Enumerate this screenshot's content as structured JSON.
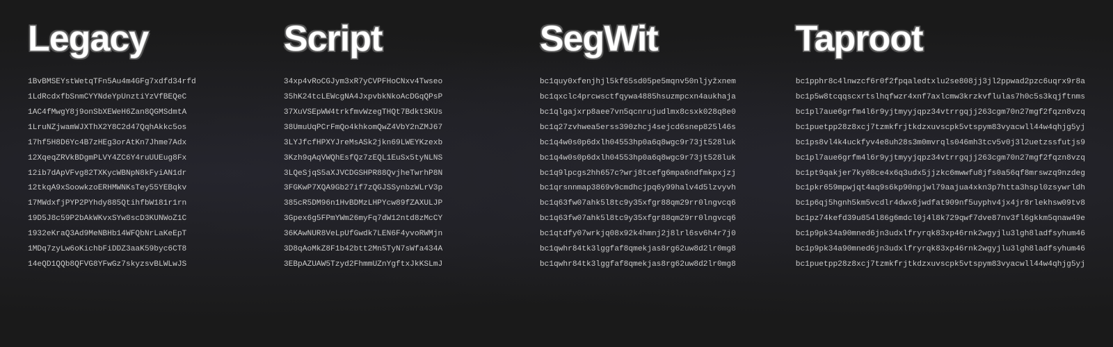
{
  "columns": [
    {
      "id": "legacy",
      "header": "Legacy",
      "addresses": [
        "1BvBMSEYstWetqTFn5Au4m4GFg7xdfd34rfd",
        "1LdRcdxfbSnmCYYNdeYpUnztiYzVfBEQeC",
        "1AC4fMwgY8j9onSbXEWeH6Zan8QGMSdmtA",
        "1LruNZjwamWJXThX2Y8C2d47QqhAkkc5os",
        "17hf5H8D6Yc4B7zHEg3orAtKn7Jhme7Adx",
        "12XqeqZRVkBDgmPLVY4ZC6Y4ruUUEug8Fx",
        "12ib7dApVFvg82TXKycWBNpN8kFyiAN1dr",
        "12tkqA9xSoowkzoERHMWNKsTey55YEBqkv",
        "17MWdxfjPYP2PYhdy885QtihfbW181r1rn",
        "19D5J8c59P2bAkWKvxSYw8scD3KUNWoZ1C",
        "1932eKraQ3Ad9MeNBHb14WFQbNrLaKeEpT",
        "1MDq7zyLw6oKichbFiDDZ3aaK59byc6CT8",
        "14eQD1QQb8QFVG8YFwGz7skyzsvBLWLwJS"
      ]
    },
    {
      "id": "script",
      "header": "Script",
      "addresses": [
        "34xp4vRoCGJym3xR7yCVPFHoCNxv4Twseo",
        "35hK24tcLEWcgNA4JxpvbkNkoAcDGqQPsP",
        "37XuVSEpWW4trkfmvWzegTHQt7BdktSKUs",
        "38UmuUqPCrFmQo4khkomQwZ4VbY2nZMJ67",
        "3LYJfcfHPXYJreMsASk2jkn69LWEYKzexb",
        "3Kzh9qAqVWQhEsfQz7zEQL1EuSx5tyNLNS",
        "3LQeSjqS5aXJVCDGSHPR88QvjheTwrhP8N",
        "3FGKwP7XQA9Gb27if7zQGJSSynbzWLrV3p",
        "385cR5DM96n1HvBDMzLHPYcw89fZAXULJP",
        "3Gpex6g5FPmYWm26myFq7dW12ntd8zMcCY",
        "36KAwNUR8VeLpUfGwdk7LEN6F4yvoRWMjn",
        "3D8qAoMkZ8F1b42btt2Mn5TyN7sWfa434A",
        "3EBpAZUAW5Tzyd2FhmmUZnYgftxJkKSLmJ"
      ]
    },
    {
      "id": "segwit",
      "header": "SegWit",
      "addresses": [
        "bc1quy0xfenjhjl5kf65sd05pe5mqnv50nljyžxnem",
        "bc1qxclc4prcwsctfqywa4885hsuzmpcxn4aukhaja",
        "bc1qlgajxrp8aee7vn5qcnrujudlmx8csxk028q8e0",
        "bc1q27zvhwea5erss390zhcj4sejcd6snep825l46s",
        "bc1q4w0s0p6dxlh04553hp0a6q8wgc9r73jt528luk",
        "bc1q4w0s0p6dxlh04553hp0a6q8wgc9r73jt528luk",
        "bc1q9lpcgs2hh657c?wrj8tcefg6mpa6ndfmkpxjzj",
        "bc1qrsnnmap3869v9cmdhcjpq6y99halv4d5lzvyvh",
        "bc1q63fw07ahk5l8tc9y35xfgr88qm29rr0lngvcq6",
        "bc1q63fw07ahk5l8tc9y35xfgr88qm29rr0lngvcq6",
        "bc1qtdfy07wrkjq08x92k4hmnj2j8lrl6sv6h4r7j0",
        "bc1qwhr84tk3lggfaf8qmekjas8rg62uw8d2lr0mg8",
        "bc1qwhr84tk3lggfaf8qmekjas8rg62uw8d2lr0mg8"
      ]
    },
    {
      "id": "taproot",
      "header": "Taproot",
      "addresses": [
        "bc1pphr8c4lnwzcf6r0f2fpqaledtxlu2se808jj3jl2ppwad2pzc6uqrx9r8a",
        "bc1p5w8tcqqscxrtslhqfwzr4xnf7axlcmw3krzkvflulas7h0c5s3kqjftnms",
        "bc1pl7aue6grfm4l6r9yjtmyyjqpz34vtrrgqjj263cgm70n27mgf2fqzn8vzq",
        "bc1puetpp28z8xcj7tzmkfrjtkdzxuvscpk5vtspym83vyacwll44w4qhjg5yj",
        "bc1ps8vl4k4uckfyv4e8uh28s3m0mvrqls046mh3tcv5v0j3l2uetzssfutjs9",
        "bc1pl7aue6grfm4l6r9yjtmyyjqpz34vtrrgqjj263cgm70n27mgf2fqzn8vzq",
        "bc1pt9qakjer7ky08ce4x6q3udx5jjzkc6mwwfu8jfs0a56qf8mrswzq9nzdeg",
        "bc1pkr659mpwjqt4aq9s6kp90npjwl79aajua4xkn3p7htta3hspl0zsywrldh",
        "bc1p6qj5hgnh5km5vcdlr4dwx6jwdfat909nf5uyphv4jx4jr8rlekhsw09tv8",
        "bc1pz74kefd39u854l86g6mdcl0j4l8k729qwf7dve87nv3fl6gkkm5qnaw49e",
        "bc1p9pk34a90mned6jn3udxlfryrqk83xp46rnk2wgyjlu3lgh8ladfsyhum46",
        "bc1p9pk34a90mned6jn3udxlfryrqk83xp46rnk2wgyjlu3lgh8ladfsyhum46",
        "bc1puetpp28z8xcj7tzmkfrjtkdzxuvscpk5vtspym83vyacwll44w4qhjg5yj"
      ]
    }
  ]
}
